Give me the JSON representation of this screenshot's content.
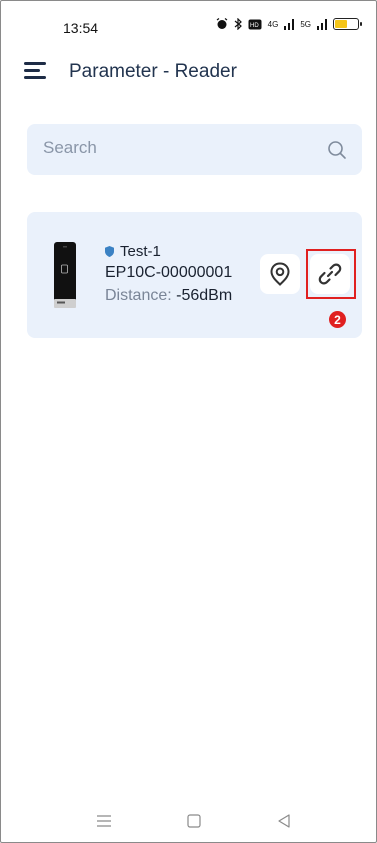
{
  "status_bar": {
    "time": "13:54",
    "network_a": "4G",
    "network_b": "5G",
    "battery_level": 0.55,
    "battery_color": "#f5c518"
  },
  "header": {
    "title": "Parameter - Reader"
  },
  "search": {
    "placeholder": "Search",
    "value": ""
  },
  "device": {
    "name": "Test-1",
    "model": "EP10C-00000001",
    "distance_label": "Distance:",
    "distance_value": "-56dBm"
  },
  "annotation": {
    "step": "2",
    "color": "#e02020"
  },
  "icons": {
    "menu": "menu-icon",
    "search": "search-icon",
    "location": "location-pin-icon",
    "link": "link-icon",
    "shield": "shield-icon"
  },
  "colors": {
    "accent": "#1e2c46",
    "card_bg": "#eaf1fb",
    "highlight": "#e02020"
  }
}
